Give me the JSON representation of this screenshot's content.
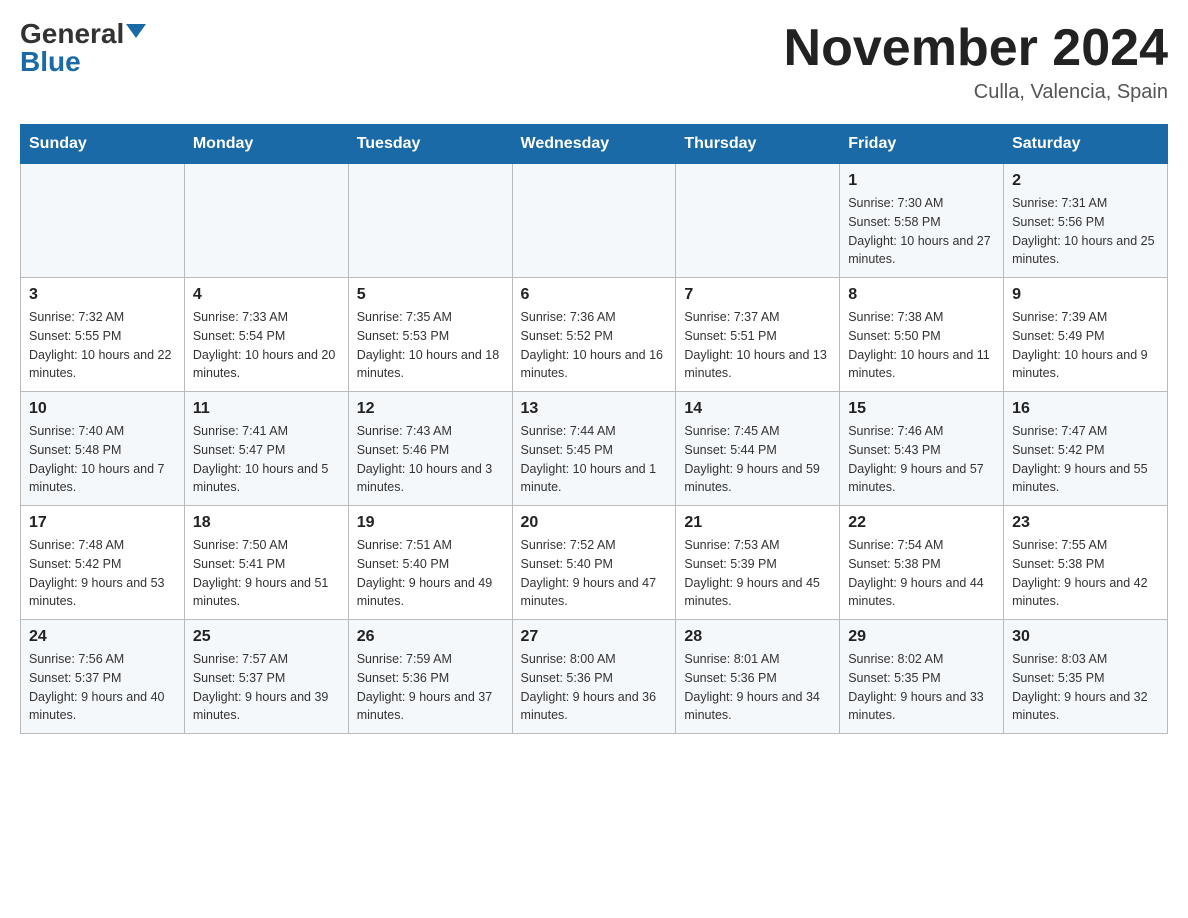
{
  "header": {
    "logo_general": "General",
    "logo_blue": "Blue",
    "month_title": "November 2024",
    "location": "Culla, Valencia, Spain"
  },
  "days_of_week": [
    "Sunday",
    "Monday",
    "Tuesday",
    "Wednesday",
    "Thursday",
    "Friday",
    "Saturday"
  ],
  "weeks": [
    {
      "cells": [
        {
          "day": "",
          "info": ""
        },
        {
          "day": "",
          "info": ""
        },
        {
          "day": "",
          "info": ""
        },
        {
          "day": "",
          "info": ""
        },
        {
          "day": "",
          "info": ""
        },
        {
          "day": "1",
          "info": "Sunrise: 7:30 AM\nSunset: 5:58 PM\nDaylight: 10 hours and 27 minutes."
        },
        {
          "day": "2",
          "info": "Sunrise: 7:31 AM\nSunset: 5:56 PM\nDaylight: 10 hours and 25 minutes."
        }
      ]
    },
    {
      "cells": [
        {
          "day": "3",
          "info": "Sunrise: 7:32 AM\nSunset: 5:55 PM\nDaylight: 10 hours and 22 minutes."
        },
        {
          "day": "4",
          "info": "Sunrise: 7:33 AM\nSunset: 5:54 PM\nDaylight: 10 hours and 20 minutes."
        },
        {
          "day": "5",
          "info": "Sunrise: 7:35 AM\nSunset: 5:53 PM\nDaylight: 10 hours and 18 minutes."
        },
        {
          "day": "6",
          "info": "Sunrise: 7:36 AM\nSunset: 5:52 PM\nDaylight: 10 hours and 16 minutes."
        },
        {
          "day": "7",
          "info": "Sunrise: 7:37 AM\nSunset: 5:51 PM\nDaylight: 10 hours and 13 minutes."
        },
        {
          "day": "8",
          "info": "Sunrise: 7:38 AM\nSunset: 5:50 PM\nDaylight: 10 hours and 11 minutes."
        },
        {
          "day": "9",
          "info": "Sunrise: 7:39 AM\nSunset: 5:49 PM\nDaylight: 10 hours and 9 minutes."
        }
      ]
    },
    {
      "cells": [
        {
          "day": "10",
          "info": "Sunrise: 7:40 AM\nSunset: 5:48 PM\nDaylight: 10 hours and 7 minutes."
        },
        {
          "day": "11",
          "info": "Sunrise: 7:41 AM\nSunset: 5:47 PM\nDaylight: 10 hours and 5 minutes."
        },
        {
          "day": "12",
          "info": "Sunrise: 7:43 AM\nSunset: 5:46 PM\nDaylight: 10 hours and 3 minutes."
        },
        {
          "day": "13",
          "info": "Sunrise: 7:44 AM\nSunset: 5:45 PM\nDaylight: 10 hours and 1 minute."
        },
        {
          "day": "14",
          "info": "Sunrise: 7:45 AM\nSunset: 5:44 PM\nDaylight: 9 hours and 59 minutes."
        },
        {
          "day": "15",
          "info": "Sunrise: 7:46 AM\nSunset: 5:43 PM\nDaylight: 9 hours and 57 minutes."
        },
        {
          "day": "16",
          "info": "Sunrise: 7:47 AM\nSunset: 5:42 PM\nDaylight: 9 hours and 55 minutes."
        }
      ]
    },
    {
      "cells": [
        {
          "day": "17",
          "info": "Sunrise: 7:48 AM\nSunset: 5:42 PM\nDaylight: 9 hours and 53 minutes."
        },
        {
          "day": "18",
          "info": "Sunrise: 7:50 AM\nSunset: 5:41 PM\nDaylight: 9 hours and 51 minutes."
        },
        {
          "day": "19",
          "info": "Sunrise: 7:51 AM\nSunset: 5:40 PM\nDaylight: 9 hours and 49 minutes."
        },
        {
          "day": "20",
          "info": "Sunrise: 7:52 AM\nSunset: 5:40 PM\nDaylight: 9 hours and 47 minutes."
        },
        {
          "day": "21",
          "info": "Sunrise: 7:53 AM\nSunset: 5:39 PM\nDaylight: 9 hours and 45 minutes."
        },
        {
          "day": "22",
          "info": "Sunrise: 7:54 AM\nSunset: 5:38 PM\nDaylight: 9 hours and 44 minutes."
        },
        {
          "day": "23",
          "info": "Sunrise: 7:55 AM\nSunset: 5:38 PM\nDaylight: 9 hours and 42 minutes."
        }
      ]
    },
    {
      "cells": [
        {
          "day": "24",
          "info": "Sunrise: 7:56 AM\nSunset: 5:37 PM\nDaylight: 9 hours and 40 minutes."
        },
        {
          "day": "25",
          "info": "Sunrise: 7:57 AM\nSunset: 5:37 PM\nDaylight: 9 hours and 39 minutes."
        },
        {
          "day": "26",
          "info": "Sunrise: 7:59 AM\nSunset: 5:36 PM\nDaylight: 9 hours and 37 minutes."
        },
        {
          "day": "27",
          "info": "Sunrise: 8:00 AM\nSunset: 5:36 PM\nDaylight: 9 hours and 36 minutes."
        },
        {
          "day": "28",
          "info": "Sunrise: 8:01 AM\nSunset: 5:36 PM\nDaylight: 9 hours and 34 minutes."
        },
        {
          "day": "29",
          "info": "Sunrise: 8:02 AM\nSunset: 5:35 PM\nDaylight: 9 hours and 33 minutes."
        },
        {
          "day": "30",
          "info": "Sunrise: 8:03 AM\nSunset: 5:35 PM\nDaylight: 9 hours and 32 minutes."
        }
      ]
    }
  ]
}
